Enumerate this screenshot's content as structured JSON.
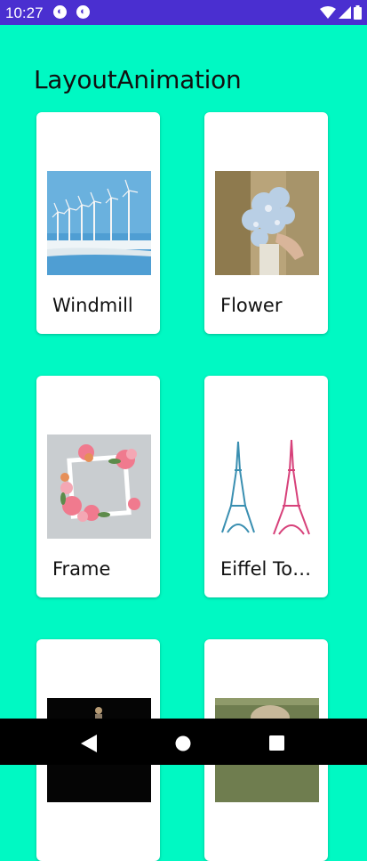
{
  "status_bar": {
    "time": "10:27"
  },
  "app": {
    "title": "LayoutAnimation"
  },
  "cards": [
    {
      "label": "Windmill",
      "icon": "windmill-image"
    },
    {
      "label": "Flower",
      "icon": "flower-image"
    },
    {
      "label": "Frame",
      "icon": "frame-image"
    },
    {
      "label": "Eiffel Tower",
      "icon": "eiffel-tower-image"
    },
    {
      "label": "",
      "icon": "dark-image"
    },
    {
      "label": "",
      "icon": "field-image"
    }
  ],
  "colors": {
    "background": "#00f9c3",
    "status_bar": "#4a2fd0",
    "nav_bar": "#000000"
  }
}
